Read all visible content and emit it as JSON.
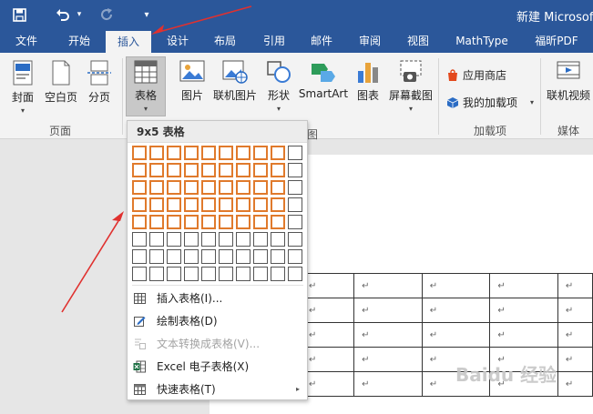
{
  "titlebar": {
    "doc_title": "新建 Microsoft",
    "qa_customize": "▾"
  },
  "tabs": [
    {
      "label": "文件"
    },
    {
      "label": "开始"
    },
    {
      "label": "插入"
    },
    {
      "label": "设计"
    },
    {
      "label": "布局"
    },
    {
      "label": "引用"
    },
    {
      "label": "邮件"
    },
    {
      "label": "审阅"
    },
    {
      "label": "视图"
    },
    {
      "label": "MathType"
    },
    {
      "label": "福昕PDF"
    }
  ],
  "ribbon": {
    "pages_group": {
      "label": "页面",
      "buttons": [
        {
          "label": "封面"
        },
        {
          "label": "空白页"
        },
        {
          "label": "分页"
        }
      ]
    },
    "table_button": {
      "label": "表格"
    },
    "illustrations_group": {
      "buttons": [
        {
          "label": "图片"
        },
        {
          "label": "联机图片"
        },
        {
          "label": "形状"
        },
        {
          "label": "SmartArt"
        },
        {
          "label": "图表"
        },
        {
          "label": "屏幕截图"
        }
      ]
    },
    "addins_group": {
      "label": "加载项",
      "store": "应用商店",
      "my_addins": "我的加载项"
    },
    "media_group": {
      "label": "媒体",
      "online_video": "联机视频"
    },
    "caret": "▾"
  },
  "table_dropdown": {
    "header": "9x5 表格",
    "grid": {
      "cols": 10,
      "rows": 8,
      "selected_cols": 9,
      "selected_rows": 5
    },
    "menu": [
      {
        "label": "插入表格(I)...",
        "enabled": true
      },
      {
        "label": "绘制表格(D)",
        "enabled": true
      },
      {
        "label": "文本转换成表格(V)...",
        "enabled": false
      },
      {
        "label": "Excel 电子表格(X)",
        "enabled": true
      },
      {
        "label": "快速表格(T)",
        "enabled": true,
        "submenu": true
      }
    ],
    "submenu_arrow": "▸",
    "hidden_group_label_tail": "图"
  },
  "document": {
    "cell_mark": "↵",
    "rows": 5,
    "cols": 5
  },
  "colors": {
    "brand": "#2b579a",
    "grid_selected": "#e07a2c",
    "annotation": "#e0312f"
  }
}
